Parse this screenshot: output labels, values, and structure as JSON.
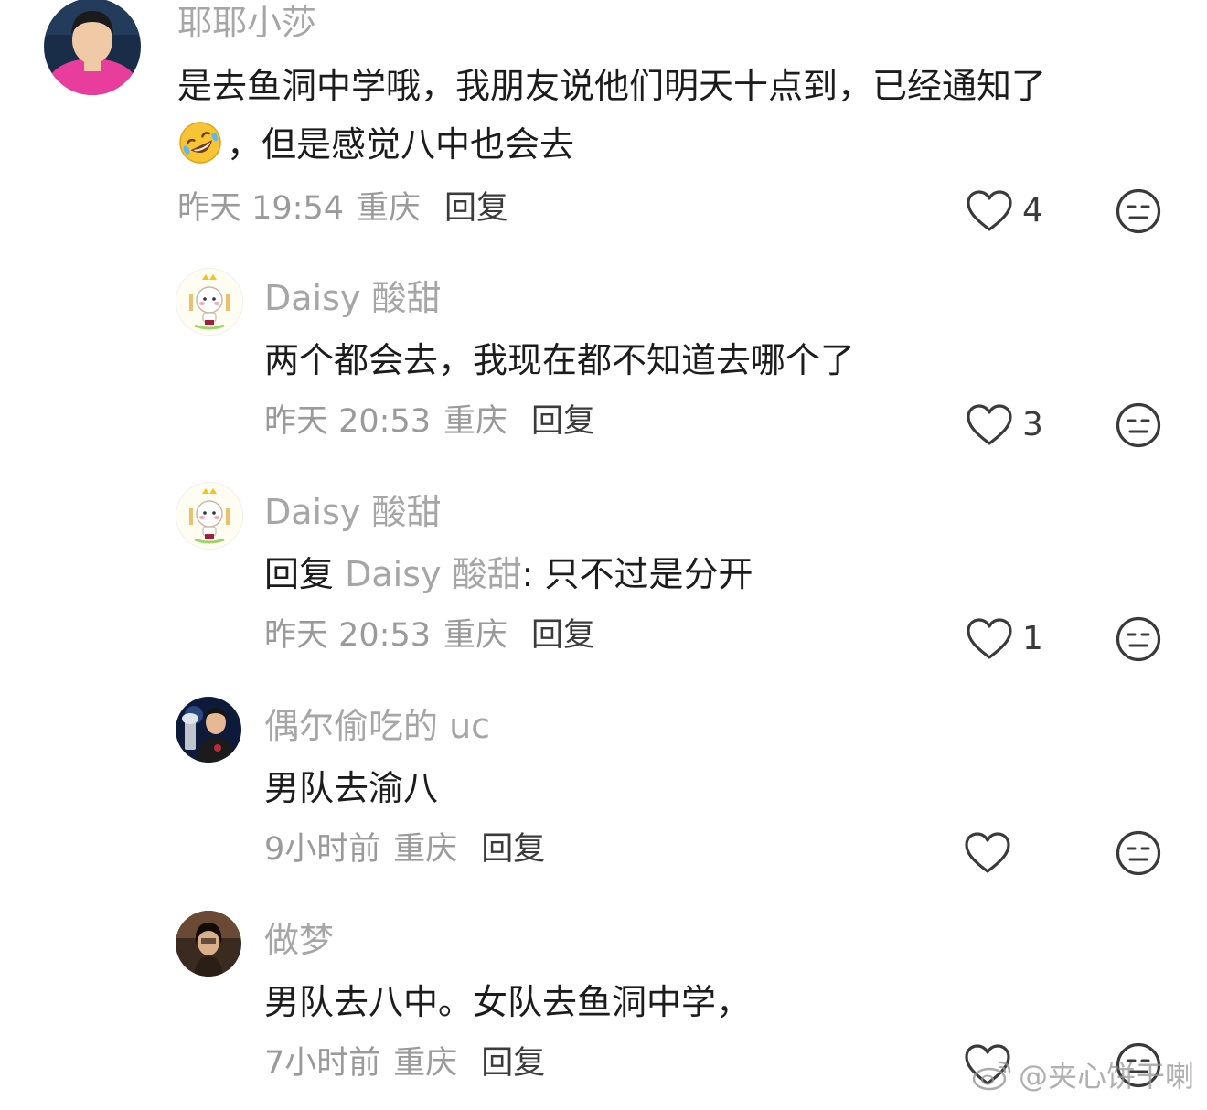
{
  "comments": [
    {
      "username": "耶耶小莎",
      "lines": [
        "是去鱼洞中学哦，我朋友说他们明天十点到，已经通知了",
        "，但是感觉八中也会去"
      ],
      "emoji": "rofl-emoji",
      "time": "昨天 19:54",
      "location": "重庆",
      "reply_label": "回复",
      "likes": "4"
    },
    {
      "username": "Daisy 酸甜",
      "text": "两个都会去，我现在都不知道去哪个了",
      "time": "昨天 20:53",
      "location": "重庆",
      "reply_label": "回复",
      "likes": "3"
    },
    {
      "username": "Daisy 酸甜",
      "reply_prefix": "回复 ",
      "reply_to": "Daisy 酸甜",
      "text": ": 只不过是分开",
      "time": "昨天 20:53",
      "location": "重庆",
      "reply_label": "回复",
      "likes": "1"
    },
    {
      "username": "偶尔偷吃的 uc",
      "text": "男队去渝八",
      "time": "9小时前",
      "location": "重庆",
      "reply_label": "回复",
      "likes": ""
    },
    {
      "username": "做梦",
      "text": "男队去八中。女队去鱼洞中学，",
      "time": "7小时前",
      "location": "重庆",
      "reply_label": "回复",
      "likes": ""
    }
  ],
  "watermark": "@夹心饼干喇",
  "icons": {
    "like": "heart-outline-icon",
    "dislike": "neutral-face-icon",
    "watermark": "weibo-logo-icon"
  },
  "colors": {
    "username": "#a6a6a6",
    "text": "#1c1c1c",
    "meta": "#9a9a9a",
    "reply": "#3b3b3b"
  }
}
